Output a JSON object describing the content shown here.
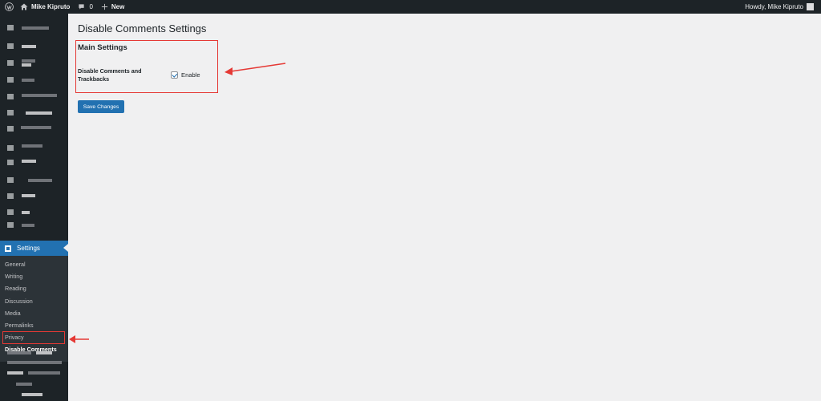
{
  "admin_bar": {
    "site_name": "Mike Kipruto",
    "comments_count": "0",
    "new_label": "New",
    "greeting": "Howdy, Mike Kipruto"
  },
  "sidebar": {
    "active_menu": "Settings",
    "submenu": [
      {
        "label": "General"
      },
      {
        "label": "Writing"
      },
      {
        "label": "Reading"
      },
      {
        "label": "Discussion"
      },
      {
        "label": "Media"
      },
      {
        "label": "Permalinks"
      },
      {
        "label": "Privacy"
      },
      {
        "label": "Disable Comments"
      }
    ]
  },
  "main": {
    "title": "Disable Comments Settings",
    "section_title": "Main Settings",
    "field_label": "Disable Comments and Trackbacks",
    "checkbox_label": "Enable",
    "checkbox_checked": true,
    "save_button": "Save Changes"
  },
  "colors": {
    "admin_dark": "#1d2327",
    "accent": "#2271b1",
    "annotation": "#e53935",
    "background": "#f0f0f1"
  }
}
